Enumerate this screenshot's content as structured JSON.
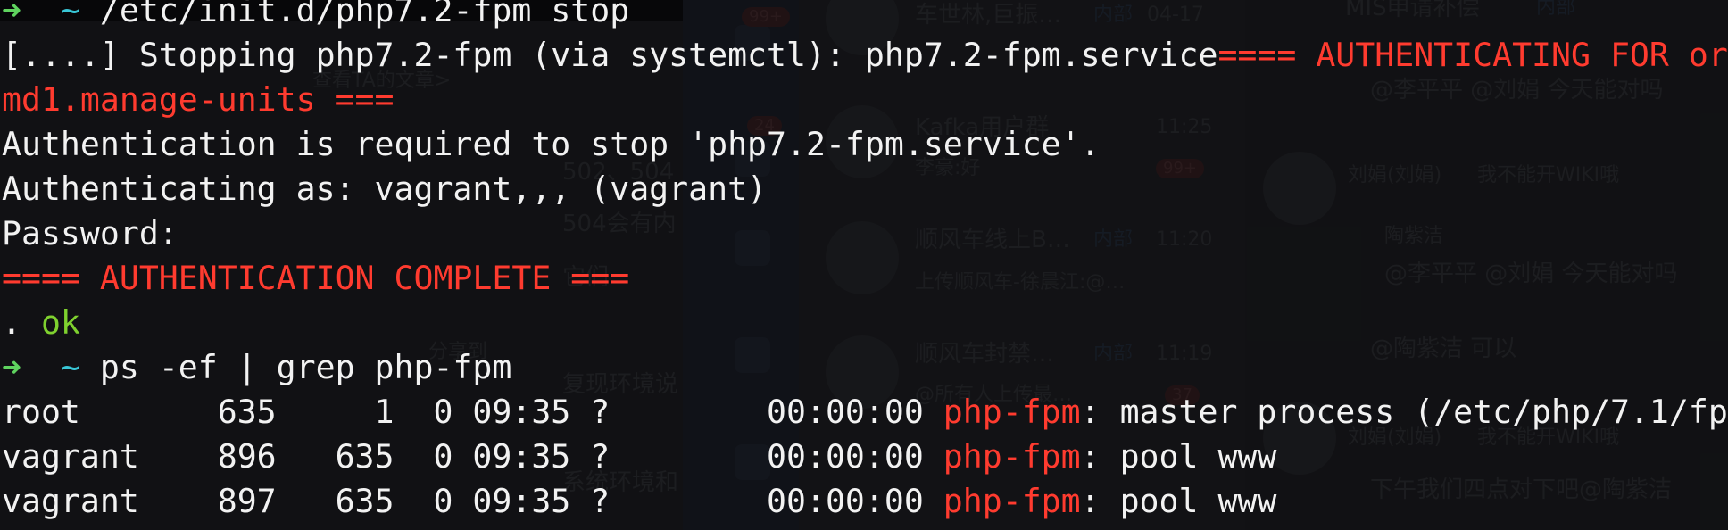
{
  "terminal": {
    "line1": {
      "arrow": "➜",
      "tilde": "~",
      "command": "/etc/init.d/php7.2-fpm stop"
    },
    "line2": {
      "prefix": "[....] Stopping php7.2-fpm (via systemctl): php7.2-fpm.service",
      "warn": "==== AUTHENTICATING FOR or"
    },
    "line3": "md1.manage-units ===",
    "line4": "Authentication is required to stop 'php7.2-fpm.service'.",
    "line5": "Authenticating as: vagrant,,, (vagrant)",
    "line6": "Password:",
    "line7": "==== AUTHENTICATION COMPLETE ===",
    "line8": {
      "dot": ". ",
      "ok": "ok"
    },
    "line9": {
      "arrow": "➜",
      "tilde": "~",
      "command": "ps -ef | grep php-fpm"
    },
    "processes": [
      {
        "cols": "root       635     1  0 09:35 ?        00:00:00 ",
        "name": "php-fpm",
        "rest": ": master process (/etc/php/7.1/fp"
      },
      {
        "cols": "vagrant    896   635  0 09:35 ?        00:00:00 ",
        "name": "php-fpm",
        "rest": ": pool www"
      },
      {
        "cols": "vagrant    897   635  0 09:35 ?        00:00:00 ",
        "name": "php-fpm",
        "rest": ": pool www"
      }
    ]
  },
  "background": {
    "left_panel": [
      "查看TA的文章>",
      "502、504",
      "504会有内",
      "它们",
      "分享到",
      "复现环境说",
      "系统环境和"
    ],
    "sidebar_badges": [
      "99+",
      "24"
    ],
    "conversations": [
      {
        "name": "车世林,巨振…",
        "tag": "内部",
        "time": "04-17",
        "badge": ""
      },
      {
        "name": "Kafka用户群",
        "tag": "",
        "time": "11:25",
        "badge": "99+",
        "preview": "李豪:好"
      },
      {
        "name": "顺风车线上B…",
        "tag": "内部",
        "time": "11:20",
        "badge": "",
        "preview": "上传顺风车-徐晨江:@…"
      },
      {
        "name": "顺风车封禁…",
        "tag": "内部",
        "time": "11:19",
        "badge": "37",
        "preview": "@所有人上传最…"
      }
    ],
    "chat": {
      "title": "MIS申请补偿",
      "title_tag": "内部",
      "messages": [
        {
          "sender": "",
          "text": "@李平平 @刘娟 今天能对吗"
        },
        {
          "sender": "刘娟(刘娟)",
          "text": "我不能开WIKI哦"
        },
        {
          "sender": "陶紫洁",
          "text": "@李平平 @刘娟 今天能对吗"
        },
        {
          "sender": "",
          "text": "@陶紫洁 可以"
        },
        {
          "sender": "刘娟(刘娟)",
          "text": "我不能开WIKI哦"
        },
        {
          "sender": "",
          "text": "下午我们四点对下吧@陶紫洁"
        }
      ]
    }
  },
  "colors": {
    "prompt_arrow": "#5fd35f",
    "prompt_tilde": "#39c6d6",
    "error_red": "#ff3b2f",
    "ok_green": "#7fd12f",
    "text": "#f2f2f2"
  }
}
